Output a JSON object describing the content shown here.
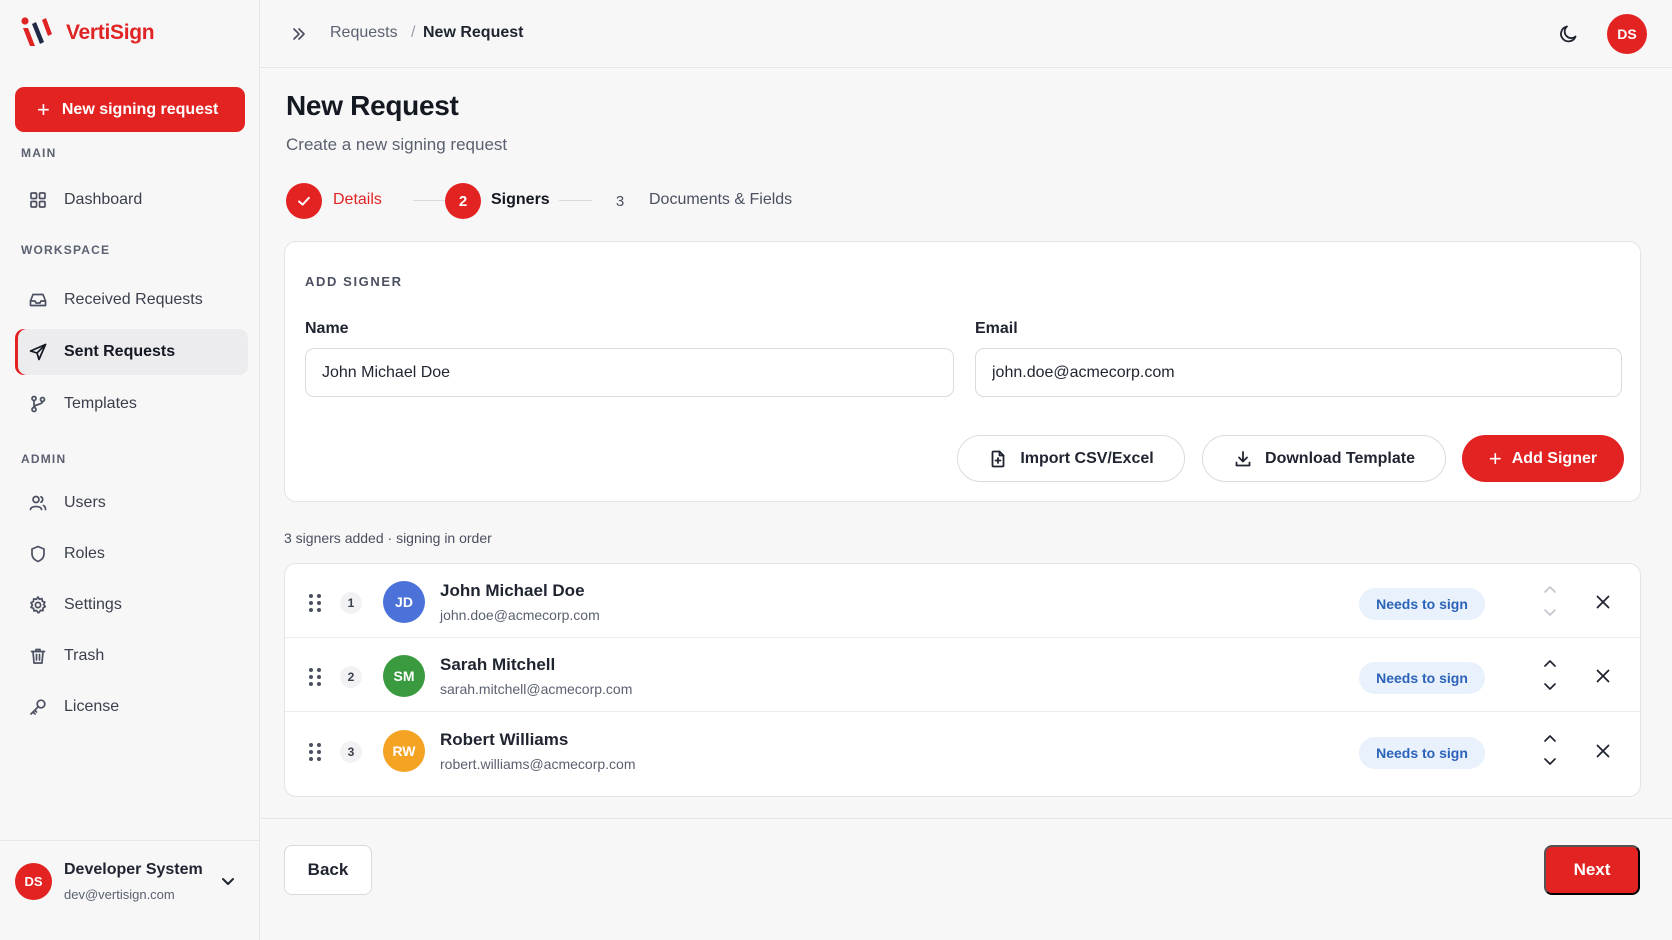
{
  "app": {
    "name": "VertiSign"
  },
  "sidebar": {
    "new_button": "New signing request",
    "sections": {
      "main": "MAIN",
      "workspace": "WORKSPACE",
      "admin": "ADMIN"
    },
    "items": [
      {
        "label": "Dashboard",
        "icon": "grid-icon"
      },
      {
        "label": "Received Requests",
        "icon": "inbox-icon"
      },
      {
        "label": "Sent Requests",
        "icon": "send-icon",
        "active": true
      },
      {
        "label": "Templates",
        "icon": "git-branch-icon"
      },
      {
        "label": "Users",
        "icon": "users-icon"
      },
      {
        "label": "Roles",
        "icon": "shield-icon"
      },
      {
        "label": "Settings",
        "icon": "gear-icon"
      },
      {
        "label": "Trash",
        "icon": "trash-icon"
      },
      {
        "label": "License",
        "icon": "key-icon"
      }
    ],
    "user": {
      "initials": "DS",
      "name": "Developer System",
      "email": "dev@vertisign.com"
    }
  },
  "header": {
    "breadcrumb": [
      "Requests",
      "New Request"
    ],
    "separator": "/",
    "avatar_initials": "DS"
  },
  "page": {
    "title": "New Request",
    "subtitle": "Create a new signing request"
  },
  "stepper": [
    {
      "number": "1",
      "label": "Details",
      "state": "complete"
    },
    {
      "number": "2",
      "label": "Signers",
      "state": "current"
    },
    {
      "number": "3",
      "label": "Documents & Fields",
      "state": "upcoming"
    }
  ],
  "add_signer": {
    "title": "ADD SIGNER",
    "name_label": "Name",
    "name_value": "John Michael Doe",
    "email_label": "Email",
    "email_value": "john.doe@acmecorp.com",
    "import_button": "Import CSV/Excel",
    "download_button": "Download Template",
    "add_button": "Add Signer"
  },
  "signers_summary": "3 signers added · signing in order",
  "signers": [
    {
      "order": "1",
      "initials": "JD",
      "name": "John Michael Doe",
      "email": "john.doe@acmecorp.com",
      "role": "Needs to sign",
      "color": "#4a72d9"
    },
    {
      "order": "2",
      "initials": "SM",
      "name": "Sarah Mitchell",
      "email": "sarah.mitchell@acmecorp.com",
      "role": "Needs to sign",
      "color": "#3a9a3f"
    },
    {
      "order": "3",
      "initials": "RW",
      "name": "Robert Williams",
      "email": "robert.williams@acmecorp.com",
      "role": "Needs to sign",
      "color": "#f4a322"
    }
  ],
  "footer": {
    "back": "Back",
    "next": "Next"
  },
  "colors": {
    "brand": "#e32222",
    "badge_bg": "#e8f1fc",
    "badge_text": "#2b63b8"
  }
}
